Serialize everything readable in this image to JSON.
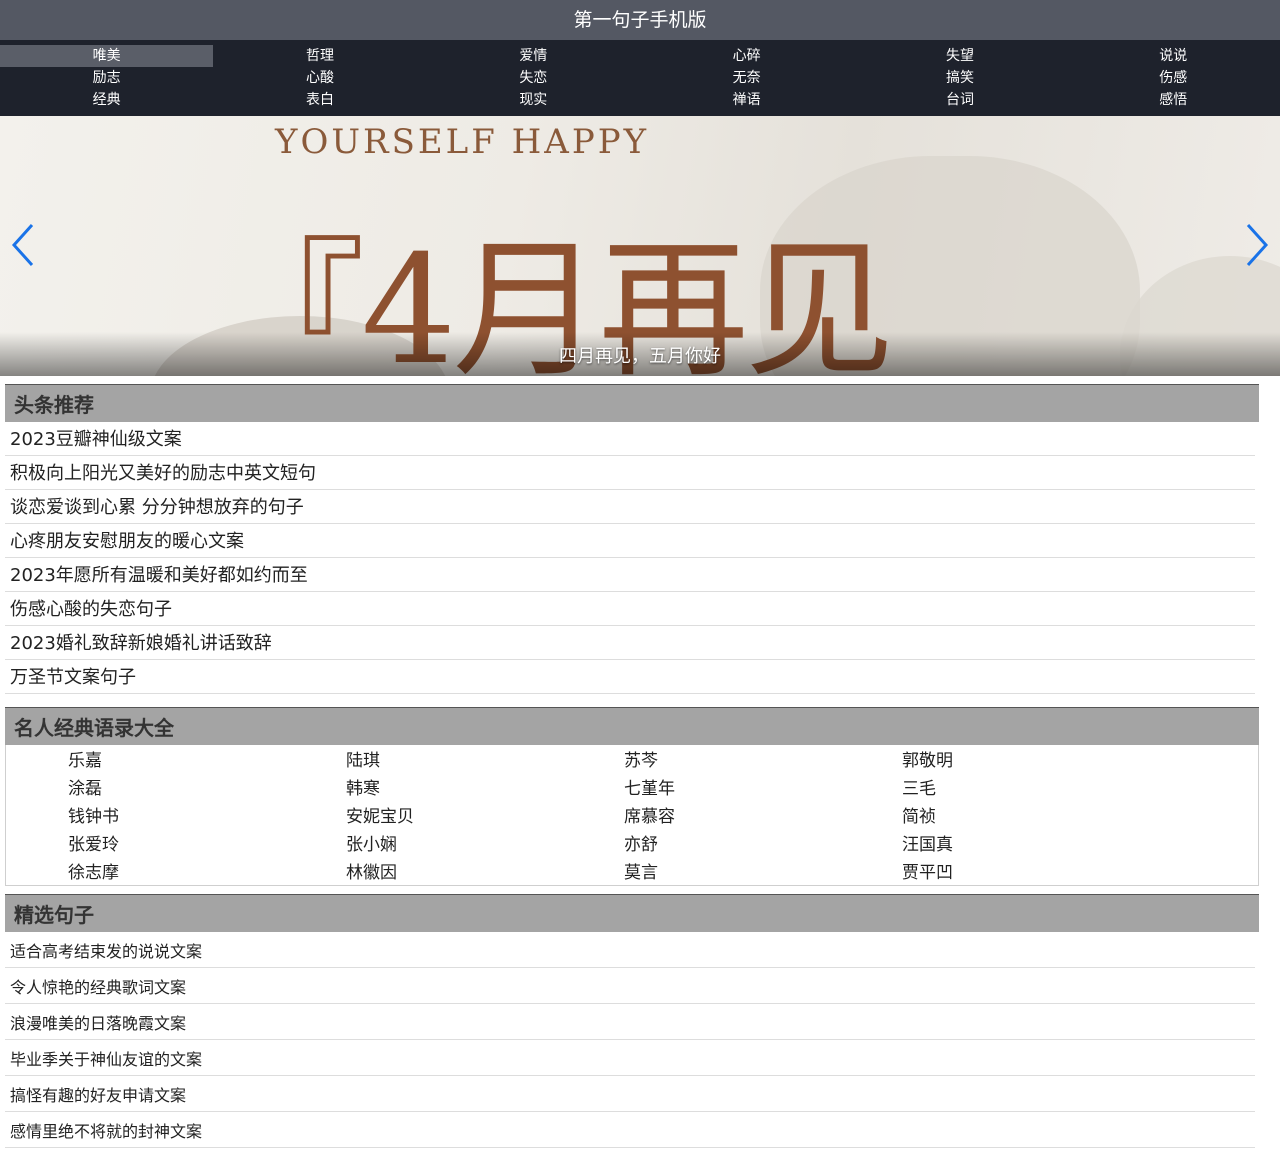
{
  "header": {
    "title": "第一句子手机版"
  },
  "nav": {
    "items": [
      "唯美",
      "哲理",
      "爱情",
      "心碎",
      "失望",
      "说说",
      "励志",
      "心酸",
      "失恋",
      "无奈",
      "搞笑",
      "伤感",
      "经典",
      "表白",
      "现实",
      "禅语",
      "台词",
      "感悟"
    ],
    "active": "唯美"
  },
  "banner": {
    "image_text_en": "YOURSELF HAPPY",
    "image_text_cn": "『4月再见",
    "caption": "四月再见，五月你好"
  },
  "headlines": {
    "title": "头条推荐",
    "items": [
      "2023豆瓣神仙级文案",
      "积极向上阳光又美好的励志中英文短句",
      "谈恋爱谈到心累 分分钟想放弃的句子",
      "心疼朋友安慰朋友的暖心文案",
      "2023年愿所有温暖和美好都如约而至",
      "伤感心酸的失恋句子",
      "2023婚礼致辞新娘婚礼讲话致辞",
      "万圣节文案句子"
    ]
  },
  "famous": {
    "title": "名人经典语录大全",
    "names": [
      "乐嘉",
      "陆琪",
      "苏芩",
      "郭敬明",
      "涂磊",
      "韩寒",
      "七堇年",
      "三毛",
      "钱钟书",
      "安妮宝贝",
      "席慕容",
      "简祯",
      "张爱玲",
      "张小娴",
      "亦舒",
      "汪国真",
      "徐志摩",
      "林徽因",
      "莫言",
      "贾平凹"
    ]
  },
  "picks": {
    "title": "精选句子",
    "items": [
      "适合高考结束发的说说文案",
      "令人惊艳的经典歌词文案",
      "浪漫唯美的日落晚霞文案",
      "毕业季关于神仙友谊的文案",
      "搞怪有趣的好友申请文案",
      "感情里绝不将就的封神文案"
    ]
  },
  "colors": {
    "topbar": "#545863",
    "nav": "#1e222c",
    "section_head": "#a4a4a4",
    "arrow": "#1a73e8"
  }
}
